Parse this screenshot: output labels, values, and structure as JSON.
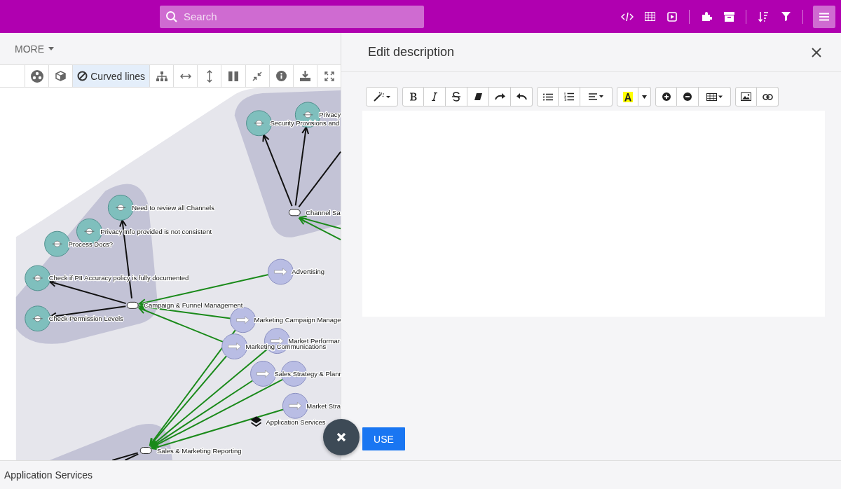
{
  "search": {
    "placeholder": "Search"
  },
  "top_actions": [
    {
      "selected": false
    },
    {
      "selected": false
    },
    {
      "selected": false
    },
    {
      "selected": false
    },
    {
      "selected": false
    },
    {
      "selected": false
    },
    {
      "selected": false
    },
    {
      "selected": true
    }
  ],
  "more_menu": {
    "label": "MORE"
  },
  "view_toolbar": [
    {
      "selected": false
    },
    {
      "selected": false
    },
    {
      "label": "Curved lines",
      "selected": true
    },
    {
      "selected": false
    },
    {
      "selected": false
    },
    {
      "selected": false
    },
    {
      "selected": false
    },
    {
      "selected": false
    },
    {
      "selected": false
    },
    {
      "selected": false
    },
    {
      "selected": false
    }
  ],
  "diagram": {
    "nodes": [
      {
        "kind": "goal",
        "label": "Privacy"
      },
      {
        "kind": "goal",
        "label": "Security Provisions and"
      },
      {
        "kind": "goal",
        "label": "Need to review all Channels"
      },
      {
        "kind": "goal",
        "label": "Privacy Info provided is not consistent"
      },
      {
        "kind": "goal",
        "label": "Process Docs?"
      },
      {
        "kind": "goal",
        "label": "Check if PII Accuracy policy is fully documented"
      },
      {
        "kind": "goal",
        "label": "Check Permission Levels"
      },
      {
        "kind": "junction",
        "label": "Channel Sa"
      },
      {
        "kind": "junction",
        "label": "Campaign & Funnel Management"
      },
      {
        "kind": "junction",
        "label": "Sales & Marketing Reporting"
      },
      {
        "kind": "capability",
        "label": "Advertising"
      },
      {
        "kind": "capability",
        "label": "Marketing Campaign Manage"
      },
      {
        "kind": "capability",
        "label": "Market Performar"
      },
      {
        "kind": "capability",
        "label": "Marketing Communications"
      },
      {
        "kind": "capability",
        "label": "Sales Strategy & Plann"
      },
      {
        "kind": "capability"
      },
      {
        "kind": "capability",
        "label": "Market Stra"
      },
      {
        "kind": "layer",
        "label": "Application Services"
      }
    ]
  },
  "panel": {
    "title": "Edit description"
  },
  "use_button": "USE",
  "status_bar": "Application Services"
}
